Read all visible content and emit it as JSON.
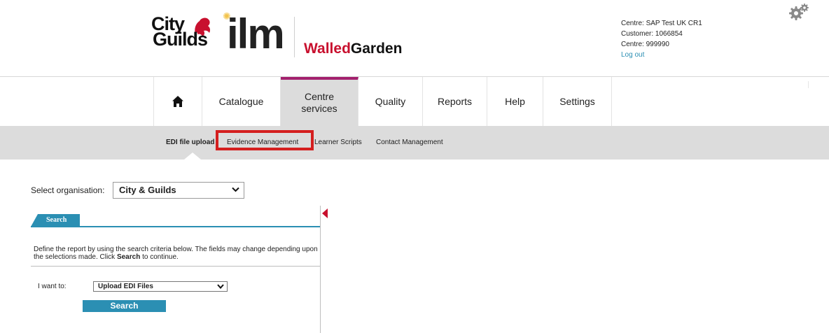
{
  "header": {
    "logo_citygilds_line1": "City",
    "logo_citygilds_amp": "&",
    "logo_citygilds_line2": "Guilds",
    "logo_ilm": "ilm",
    "brand_part1": "Walled",
    "brand_part2": "Garden",
    "brand_accent_color": "#c8102e",
    "centre_name": "Centre:  SAP Test UK CR1",
    "customer": "Customer:  1066854",
    "centre_number": "Centre:  999990",
    "logout": "Log out"
  },
  "main_nav": {
    "items": [
      {
        "label": "",
        "icon": "home-icon"
      },
      {
        "label": "Catalogue"
      },
      {
        "label": "Centre services",
        "active": true
      },
      {
        "label": "Quality"
      },
      {
        "label": "Reports"
      },
      {
        "label": "Help"
      },
      {
        "label": "Settings"
      }
    ],
    "active_color": "#a3206e"
  },
  "sub_nav": {
    "items": [
      {
        "label": "EDI file upload",
        "current": true
      },
      {
        "label": "Evidence Management",
        "highlighted": true
      },
      {
        "label": "Learner Scripts"
      },
      {
        "label": "Contact Management"
      }
    ],
    "highlight_color": "#d41f1f"
  },
  "organisation": {
    "label": "Select organisation:",
    "selected": "City & Guilds"
  },
  "search_panel": {
    "tab_label": "Search",
    "description_part1": "Define the report by using the search criteria below. The fields may change depending upon the selections made. Click ",
    "description_bold": "Search",
    "description_part2": " to continue.",
    "want_label": "I want to:",
    "want_selected": "Upload EDI Files",
    "search_button": "Search",
    "accent_color": "#2b8fb3"
  }
}
